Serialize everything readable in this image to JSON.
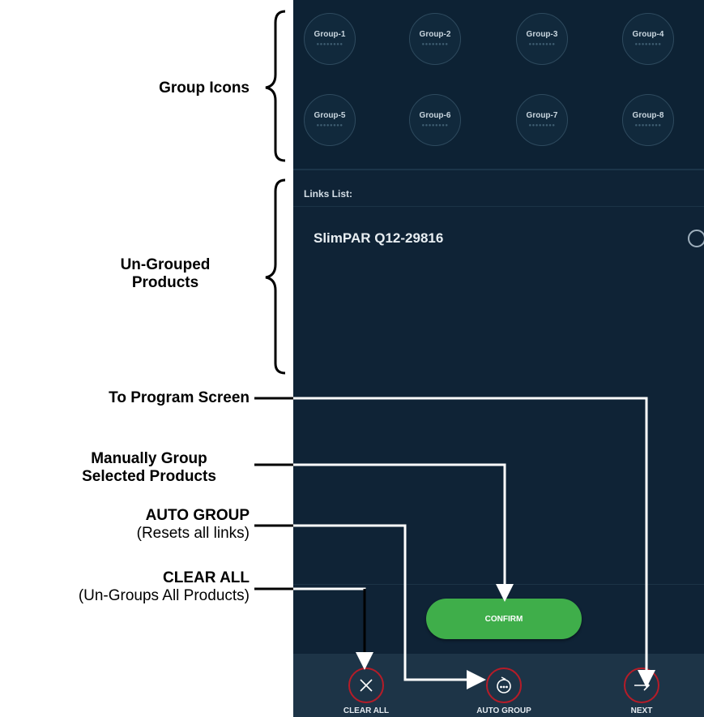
{
  "groups": [
    {
      "label": "Group-1"
    },
    {
      "label": "Group-2"
    },
    {
      "label": "Group-3"
    },
    {
      "label": "Group-4"
    },
    {
      "label": "Group-5"
    },
    {
      "label": "Group-6"
    },
    {
      "label": "Group-7"
    },
    {
      "label": "Group-8"
    }
  ],
  "links": {
    "heading": "Links List:",
    "items": [
      {
        "name": "SlimPAR Q12-29816"
      }
    ]
  },
  "confirm_label": "CONFIRM",
  "bottom_bar": {
    "clear_all": "CLEAR ALL",
    "auto_group": "AUTO GROUP",
    "next": "NEXT"
  },
  "annotations": {
    "group_icons": "Group Icons",
    "ungrouped_1": "Un-Grouped",
    "ungrouped_2": "Products",
    "to_program": "To Program Screen",
    "manual_1": "Manually Group",
    "manual_2": "Selected Products",
    "auto_title": "AUTO GROUP",
    "auto_sub": "(Resets all links)",
    "clear_title": "CLEAR ALL",
    "clear_sub": "(Un-Groups All Products)"
  },
  "colors": {
    "background": "#0f2336",
    "confirm": "#3fae4a",
    "icon_ring": "#b61c28"
  }
}
